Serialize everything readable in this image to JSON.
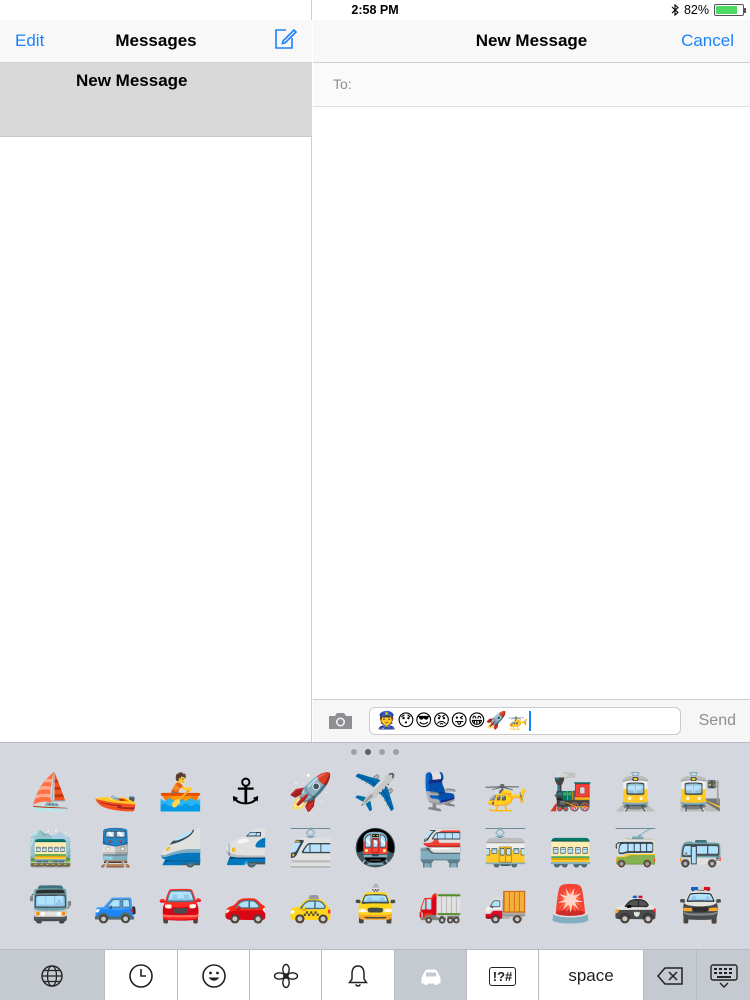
{
  "status_bar": {
    "device": "iPad",
    "time": "2:58 PM",
    "battery": "82%",
    "battery_level": 0.82
  },
  "left_pane": {
    "edit_label": "Edit",
    "title": "Messages",
    "compose_icon": "compose-icon",
    "conversations": [
      {
        "name": "New Message"
      }
    ]
  },
  "right_pane": {
    "title": "New Message",
    "cancel_label": "Cancel",
    "to_label": "To:",
    "to_value": ""
  },
  "input_bar": {
    "camera_icon": "camera-icon",
    "text": "👮😯😎😡😜😁🚀🚁",
    "send_label": "Send"
  },
  "keyboard": {
    "page_count": 4,
    "active_page": 1,
    "emojis": [
      "⛵",
      "🚤",
      "🚣",
      "⚓",
      "🚀",
      "✈️",
      "💺",
      "🚁",
      "🚂",
      "🚊",
      "🚉",
      "🚞",
      "🚆",
      "🚄",
      "🚅",
      "🚈",
      "🚇",
      "🚝",
      "🚋",
      "🚃",
      "🚎",
      "🚌",
      "🚍",
      "🚙",
      "🚘",
      "🚗",
      "🚕",
      "🚖",
      "🚛",
      "🚚",
      "🚨",
      "🚓",
      "🚔"
    ],
    "toolbar": {
      "globe_icon": "globe-icon",
      "recent_icon": "clock-icon",
      "people_icon": "smiley-icon",
      "nature_icon": "flower-icon",
      "objects_icon": "bell-icon",
      "places_icon": "car-icon",
      "symbols_label": "!?#",
      "space_label": "space",
      "delete_icon": "delete-icon",
      "dismiss_icon": "keyboard-dismiss-icon"
    }
  },
  "colors": {
    "accent": "#1a82fb",
    "keyboard_bg": "#d4d8de",
    "selected_row": "#d9d9d9"
  }
}
